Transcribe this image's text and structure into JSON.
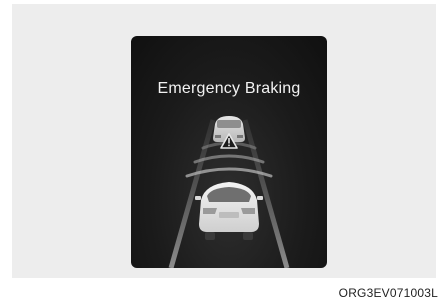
{
  "display": {
    "title": "Emergency Braking",
    "warning_icon": "warning-triangle-icon",
    "lead_vehicle_icon": "lead-vehicle-icon",
    "own_vehicle_icon": "own-vehicle-icon"
  },
  "caption": "ORG3EV071003L",
  "colors": {
    "background": "#ffffff",
    "panel": "#ededed",
    "screen": "#1b1b1b",
    "text": "#f2f2f2"
  }
}
